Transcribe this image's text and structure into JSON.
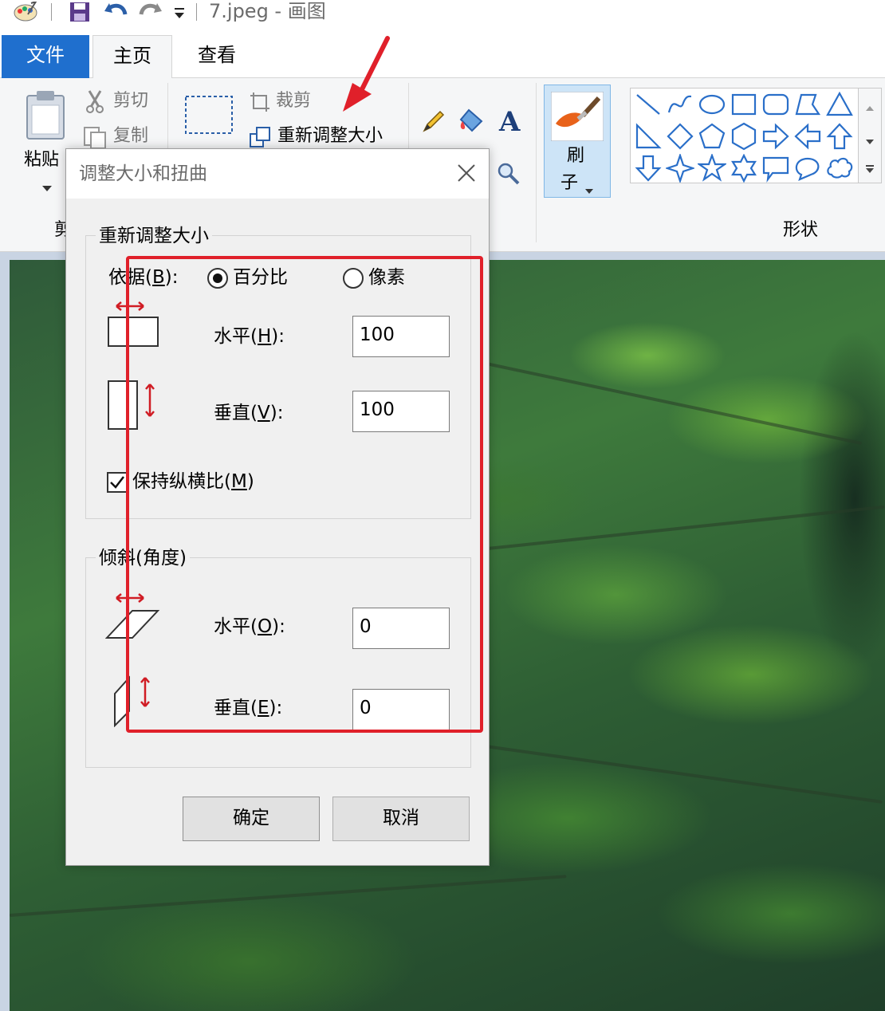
{
  "window": {
    "title": "7.jpeg - 画图",
    "quick_access": [
      "paint-app-icon",
      "save-icon",
      "undo-icon",
      "redo-icon",
      "customize-dropdown-icon"
    ]
  },
  "tabs": {
    "file": "文件",
    "home": "主页",
    "view": "查看"
  },
  "ribbon": {
    "clipboard": {
      "paste": "粘贴",
      "cut": "剪切",
      "copy": "复制",
      "group_label_partial": "剪"
    },
    "image": {
      "crop": "裁剪",
      "resize": "重新调整大小"
    },
    "brush": {
      "line1": "刷",
      "line2": "子"
    },
    "shapes": {
      "group_label": "形状"
    }
  },
  "dialog": {
    "title": "调整大小和扭曲",
    "resize_group": {
      "title": "重新调整大小",
      "by_label_prefix": "依据(",
      "by_label_key": "B",
      "by_label_suffix": "):",
      "percent": "百分比",
      "pixels": "像素",
      "selected": "percent",
      "horizontal_prefix": "水平(",
      "horizontal_key": "H",
      "horizontal_suffix": "):",
      "horizontal_value": "100",
      "vertical_prefix": "垂直(",
      "vertical_key": "V",
      "vertical_suffix": "):",
      "vertical_value": "100",
      "keep_ratio_prefix": "保持纵横比(",
      "keep_ratio_key": "M",
      "keep_ratio_suffix": ")",
      "keep_ratio_checked": true
    },
    "skew_group": {
      "title": "倾斜(角度)",
      "horizontal_prefix": "水平(",
      "horizontal_key": "O",
      "horizontal_suffix": "):",
      "horizontal_value": "0",
      "vertical_prefix": "垂直(",
      "vertical_key": "E",
      "vertical_suffix": "):",
      "vertical_value": "0"
    },
    "ok": "确定",
    "cancel": "取消"
  },
  "colors": {
    "accent": "#1f6fce",
    "annotation_red": "#e0202a",
    "shape_blue": "#2a6fc9"
  }
}
